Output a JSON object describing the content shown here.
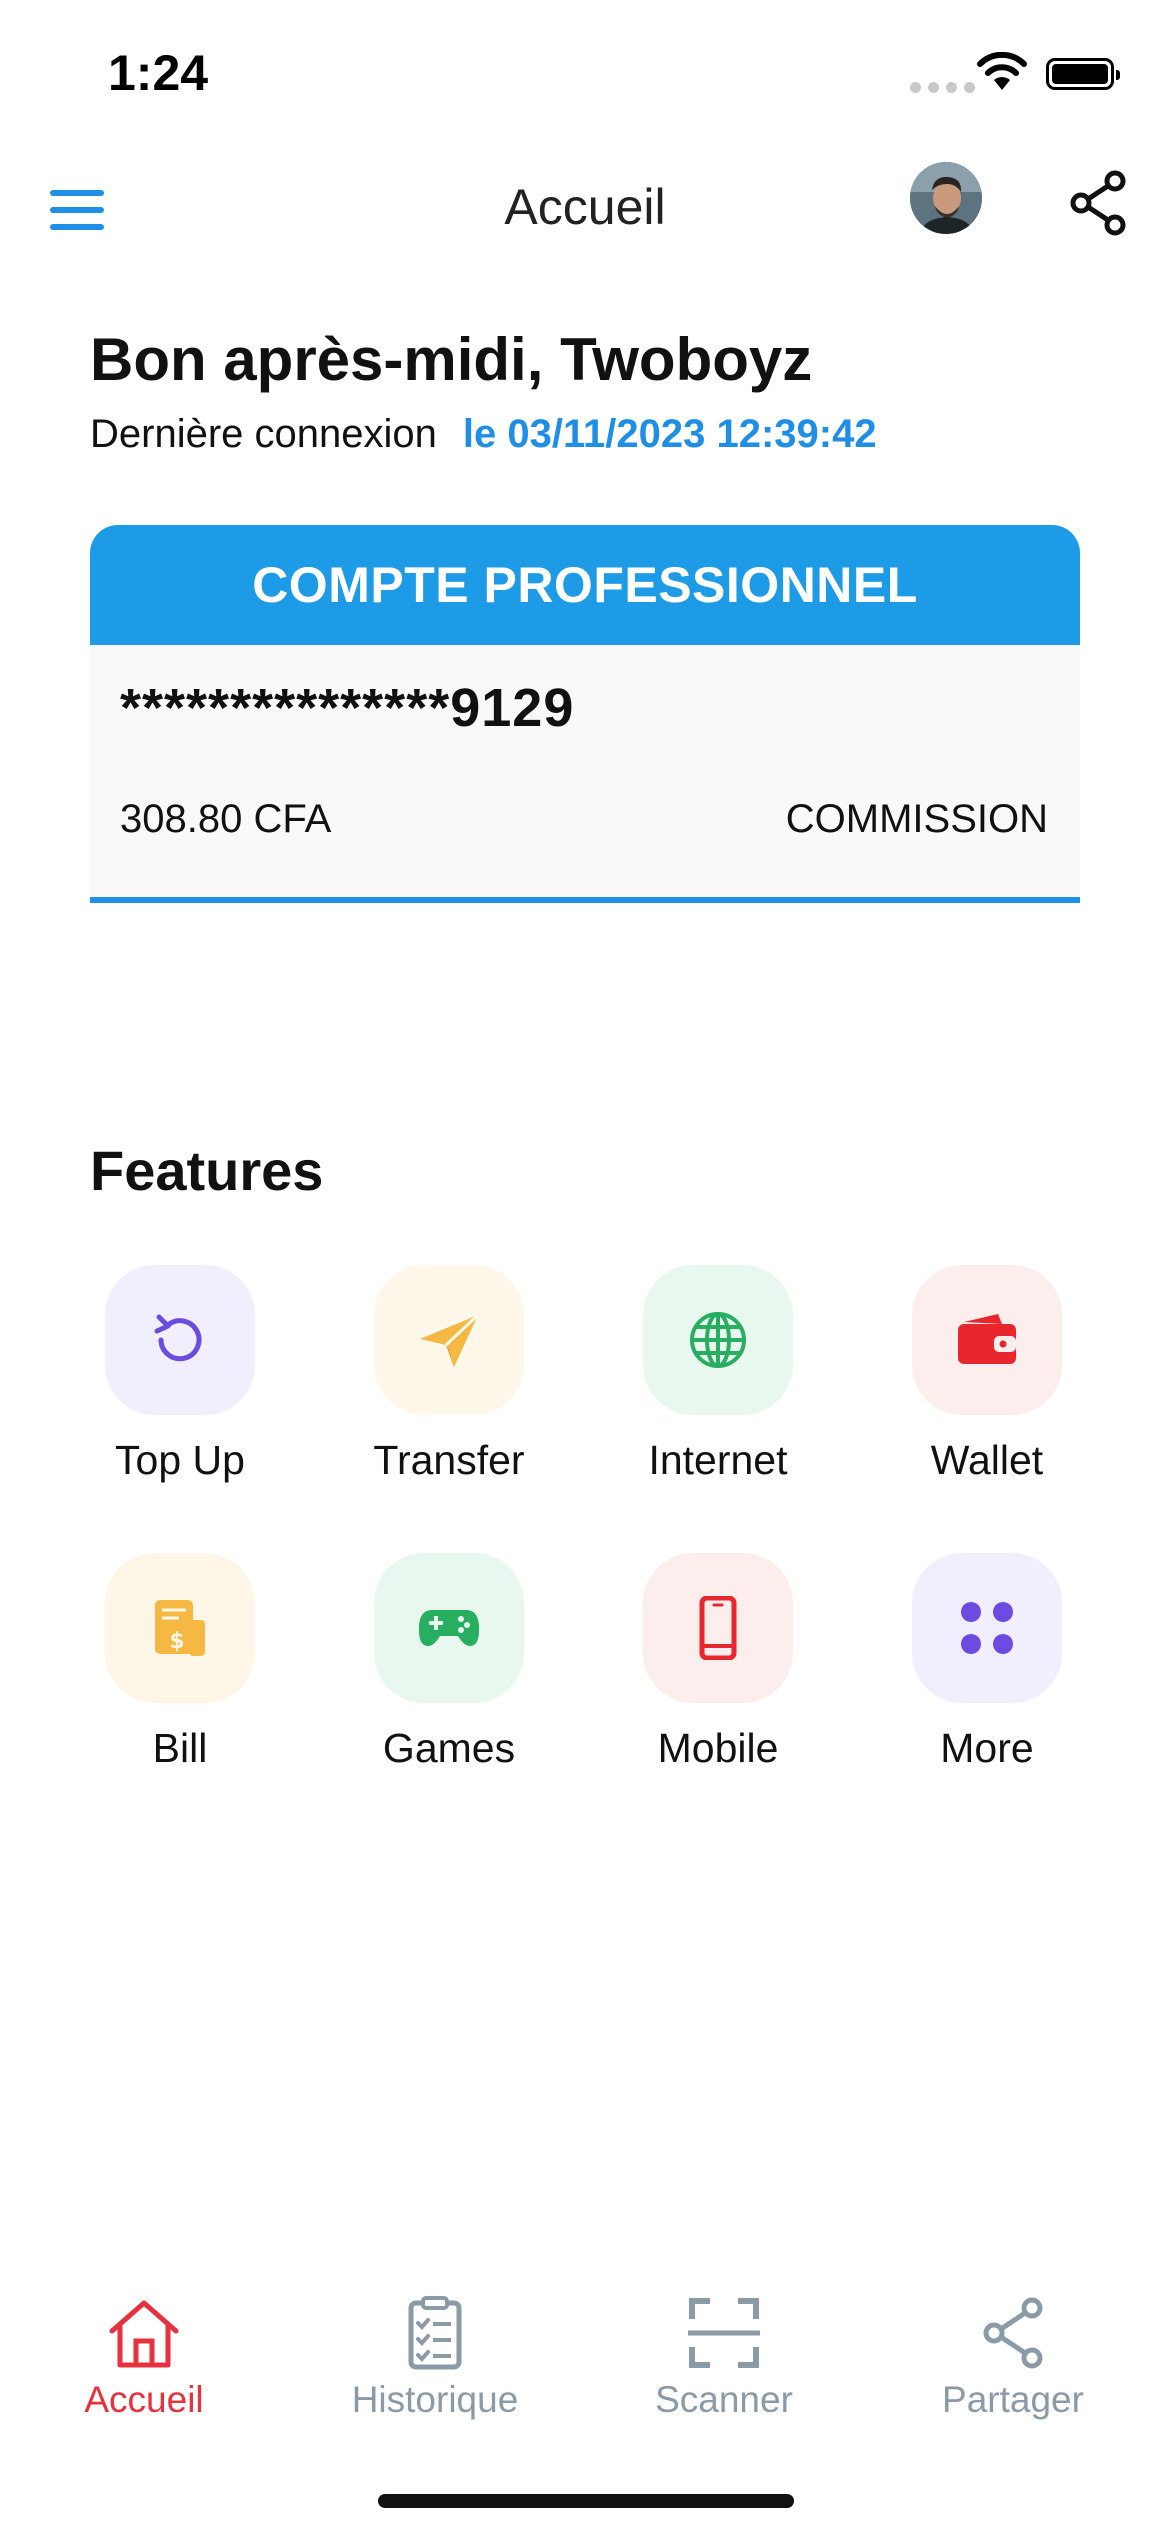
{
  "status_bar": {
    "time": "1:24"
  },
  "nav": {
    "title": "Accueil",
    "menu_icon": "hamburger-menu-icon",
    "avatar_icon": "user-avatar",
    "share_icon": "share-icon"
  },
  "greeting": {
    "text": "Bon après-midi, Twoboyz",
    "last_login_label": "Dernière connexion",
    "last_login_value": "le 03/11/2023 12:39:42"
  },
  "account": {
    "type_header": "COMPTE PROFESSIONNEL",
    "number": "***************9129",
    "balance": "308.80 CFA",
    "kind": "COMMISSION"
  },
  "features": {
    "title": "Features",
    "items": [
      {
        "label": "Top Up",
        "icon": "refresh-icon",
        "tile_color": "#f1eefd",
        "icon_color": "#6c4be0"
      },
      {
        "label": "Transfer",
        "icon": "paper-plane-icon",
        "tile_color": "#fef7ea",
        "icon_color": "#f5b843"
      },
      {
        "label": "Internet",
        "icon": "globe-icon",
        "tile_color": "#e9f8ef",
        "icon_color": "#27ae60"
      },
      {
        "label": "Wallet",
        "icon": "wallet-icon",
        "tile_color": "#fdeeee",
        "icon_color": "#e8262e"
      },
      {
        "label": "Bill",
        "icon": "bill-icon",
        "tile_color": "#fef6e6",
        "icon_color": "#f5b843"
      },
      {
        "label": "Games",
        "icon": "gamepad-icon",
        "tile_color": "#e9f8ef",
        "icon_color": "#27ae60"
      },
      {
        "label": "Mobile",
        "icon": "smartphone-icon",
        "tile_color": "#fdeeee",
        "icon_color": "#e8262e"
      },
      {
        "label": "More",
        "icon": "grid-dots-icon",
        "tile_color": "#f1eefd",
        "icon_color": "#6c4be0"
      }
    ]
  },
  "tab_bar": {
    "items": [
      {
        "label": "Accueil",
        "icon": "home-icon",
        "active": true
      },
      {
        "label": "Historique",
        "icon": "clipboard-list-icon",
        "active": false
      },
      {
        "label": "Scanner",
        "icon": "scan-frame-icon",
        "active": false
      },
      {
        "label": "Partager",
        "icon": "share-icon",
        "active": false
      }
    ]
  },
  "colors": {
    "accent": "#1f8fe6",
    "active_tab": "#e8313f",
    "inactive_tab": "#8a9aa6"
  }
}
